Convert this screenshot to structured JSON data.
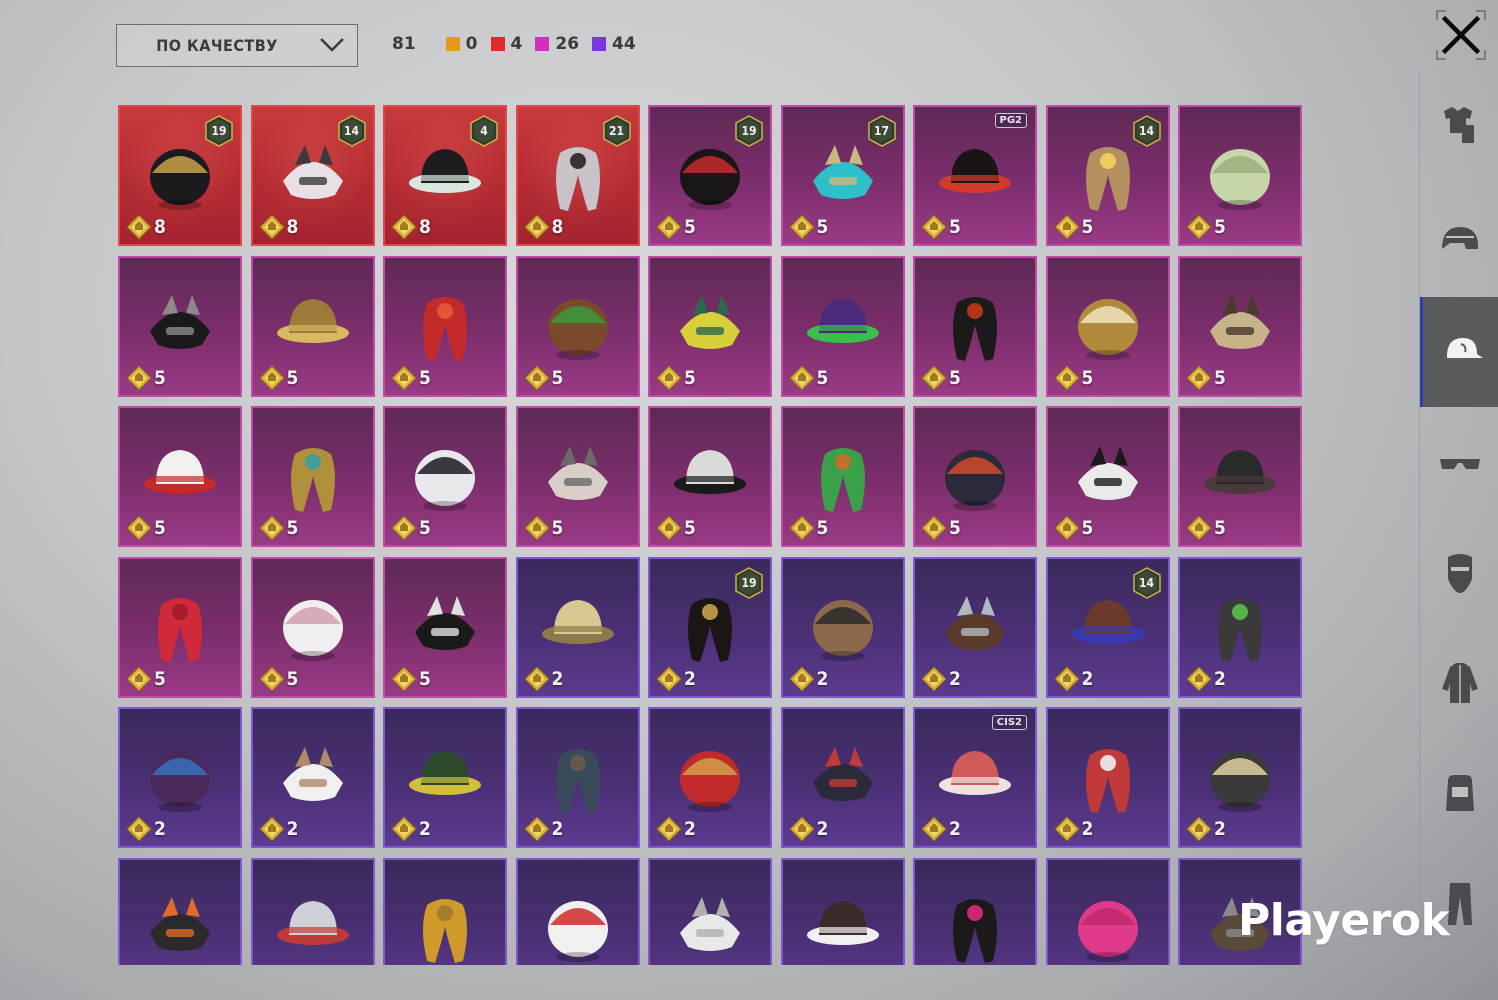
{
  "sort": {
    "label": "ПО КАЧЕСТВУ"
  },
  "counts": {
    "total": "81",
    "items": [
      {
        "color": "#e59a1c",
        "value": "0"
      },
      {
        "color": "#e12a2a",
        "value": "4"
      },
      {
        "color": "#d22fc0",
        "value": "26"
      },
      {
        "color": "#7a36e0",
        "value": "44"
      }
    ]
  },
  "watermark": "Playerok",
  "tiles": [
    {
      "rarity": "red",
      "cost": "8",
      "level": "19",
      "icon": "laurel-hair-icon"
    },
    {
      "rarity": "red",
      "cost": "8",
      "level": "14",
      "icon": "cat-mask-icon"
    },
    {
      "rarity": "red",
      "cost": "8",
      "level": "4",
      "icon": "snowman-hat-icon"
    },
    {
      "rarity": "red",
      "cost": "8",
      "level": "21",
      "icon": "demon-mask-icon"
    },
    {
      "rarity": "pink",
      "cost": "5",
      "level": "19",
      "icon": "headphones-hair-icon"
    },
    {
      "rarity": "pink",
      "cost": "5",
      "level": "17",
      "icon": "bucket-hat-hair-icon"
    },
    {
      "rarity": "pink",
      "cost": "5",
      "tag": "PG2",
      "icon": "ponytail-icon"
    },
    {
      "rarity": "pink",
      "cost": "5",
      "level": "14",
      "icon": "flower-hair-icon"
    },
    {
      "rarity": "pink",
      "cost": "5",
      "icon": "long-hair-icon"
    },
    {
      "rarity": "pink",
      "cost": "5",
      "icon": "dark-hair-icon"
    },
    {
      "rarity": "pink",
      "cost": "5",
      "icon": "gold-helmet-icon"
    },
    {
      "rarity": "pink",
      "cost": "5",
      "icon": "red-headset-icon"
    },
    {
      "rarity": "pink",
      "cost": "5",
      "icon": "dino-mask-icon"
    },
    {
      "rarity": "pink",
      "cost": "5",
      "icon": "yellow-bucket-hat-icon"
    },
    {
      "rarity": "pink",
      "cost": "5",
      "icon": "purple-beast-helmet-icon"
    },
    {
      "rarity": "pink",
      "cost": "5",
      "icon": "top-hat-icon"
    },
    {
      "rarity": "pink",
      "cost": "5",
      "icon": "gold-crown-hat-icon"
    },
    {
      "rarity": "pink",
      "cost": "5",
      "icon": "knight-helmet-icon"
    },
    {
      "rarity": "pink",
      "cost": "5",
      "icon": "snowman-head-icon"
    },
    {
      "rarity": "pink",
      "cost": "5",
      "icon": "gold-warrior-helmet-icon"
    },
    {
      "rarity": "pink",
      "cost": "5",
      "icon": "cyber-cat-helmet-icon"
    },
    {
      "rarity": "pink",
      "cost": "5",
      "icon": "dreadlocks-icon"
    },
    {
      "rarity": "pink",
      "cost": "5",
      "icon": "zebra-mask-icon"
    },
    {
      "rarity": "pink",
      "cost": "5",
      "icon": "frog-pilot-hat-icon"
    },
    {
      "rarity": "pink",
      "cost": "5",
      "icon": "tactical-helmet-icon"
    },
    {
      "rarity": "pink",
      "cost": "5",
      "icon": "beanie-icon"
    },
    {
      "rarity": "pink",
      "cost": "5",
      "icon": "antler-headband-icon"
    },
    {
      "rarity": "pink",
      "cost": "5",
      "icon": "devil-horns-icon"
    },
    {
      "rarity": "pink",
      "cost": "5",
      "icon": "white-sun-hat-icon"
    },
    {
      "rarity": "pink",
      "cost": "5",
      "icon": "skull-balaclava-icon"
    },
    {
      "rarity": "purple",
      "cost": "2",
      "icon": "straw-cowboy-hat-icon"
    },
    {
      "rarity": "purple",
      "cost": "2",
      "level": "19",
      "icon": "laurel-updo-icon"
    },
    {
      "rarity": "purple",
      "cost": "2",
      "icon": "aviator-cap-icon"
    },
    {
      "rarity": "purple",
      "cost": "2",
      "icon": "visor-hair-icon"
    },
    {
      "rarity": "purple",
      "cost": "2",
      "level": "14",
      "icon": "cat-ear-hair-icon"
    },
    {
      "rarity": "purple",
      "cost": "2",
      "icon": "gas-mask-helmet-icon"
    },
    {
      "rarity": "purple",
      "cost": "2",
      "icon": "tech-bun-icon"
    },
    {
      "rarity": "purple",
      "cost": "2",
      "icon": "wide-brim-hat-icon"
    },
    {
      "rarity": "purple",
      "cost": "2",
      "icon": "green-helmet-icon"
    },
    {
      "rarity": "purple",
      "cost": "2",
      "icon": "dark-beanie-icon"
    },
    {
      "rarity": "purple",
      "cost": "2",
      "icon": "gold-cap-icon"
    },
    {
      "rarity": "purple",
      "cost": "2",
      "icon": "red-bucket-hat-icon"
    },
    {
      "rarity": "purple",
      "cost": "2",
      "tag": "CIS2",
      "icon": "striped-cap-icon"
    },
    {
      "rarity": "purple",
      "cost": "2",
      "icon": "football-helmet-icon"
    },
    {
      "rarity": "purple",
      "cost": "2",
      "icon": "sombrero-icon"
    },
    {
      "rarity": "purple",
      "icon": "braided-helmet-icon"
    },
    {
      "rarity": "purple",
      "icon": "goggles-cap-icon"
    },
    {
      "rarity": "purple",
      "icon": "orange-beanie-icon"
    },
    {
      "rarity": "purple",
      "icon": "striped-scarf-hat-icon"
    },
    {
      "rarity": "purple",
      "icon": "turban-icon"
    },
    {
      "rarity": "purple",
      "icon": "oni-mask-icon"
    },
    {
      "rarity": "purple",
      "icon": "pink-cap-icon"
    },
    {
      "rarity": "purple",
      "icon": "pink-beret-icon"
    },
    {
      "rarity": "purple",
      "icon": "pilot-hair-icon"
    }
  ],
  "sidebar": [
    {
      "icon": "outfit-icon"
    },
    {
      "icon": "helmet-icon"
    },
    {
      "icon": "cap-icon",
      "active": true
    },
    {
      "icon": "glasses-icon"
    },
    {
      "icon": "mask-icon"
    },
    {
      "icon": "jacket-icon"
    },
    {
      "icon": "backpack-icon"
    },
    {
      "icon": "pants-icon"
    }
  ]
}
